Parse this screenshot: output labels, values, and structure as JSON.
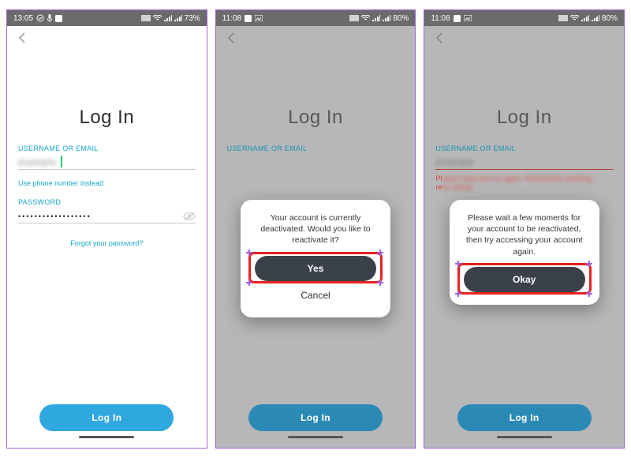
{
  "screens": [
    {
      "status": {
        "time": "13:05",
        "battery": "73%"
      },
      "title": "Log In",
      "username_label": "USERNAME OR EMAIL",
      "username_value": "example",
      "alt_link": "Use phone number instead",
      "password_label": "PASSWORD",
      "password_value": "••••••••••••••••••",
      "forgot": "Forgot your password?",
      "login_button": "Log In"
    },
    {
      "status": {
        "time": "11:08",
        "battery": "80%"
      },
      "title": "Log In",
      "username_label": "USERNAME OR EMAIL",
      "login_button": "Log In",
      "modal": {
        "text": "Your account is currently deactivated. Would you like to reactivate it?",
        "primary": "Yes",
        "secondary": "Cancel"
      }
    },
    {
      "status": {
        "time": "11:08",
        "battery": "80%"
      },
      "title": "Log In",
      "username_label": "USERNAME OR EMAIL",
      "login_button": "Log In",
      "modal": {
        "text": "Please wait a few moments for your account to be reactivated, then try accessing your account again.",
        "primary": "Okay"
      }
    }
  ]
}
